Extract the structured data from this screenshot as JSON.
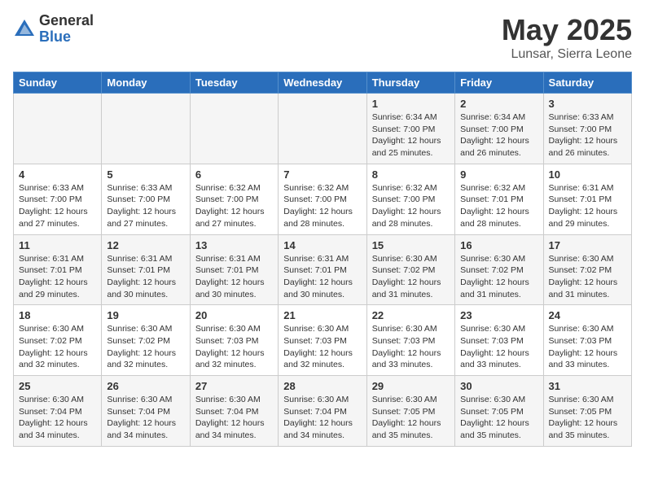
{
  "header": {
    "logo_general": "General",
    "logo_blue": "Blue",
    "title": "May 2025",
    "subtitle": "Lunsar, Sierra Leone"
  },
  "weekdays": [
    "Sunday",
    "Monday",
    "Tuesday",
    "Wednesday",
    "Thursday",
    "Friday",
    "Saturday"
  ],
  "weeks": [
    [
      {
        "day": "",
        "info": ""
      },
      {
        "day": "",
        "info": ""
      },
      {
        "day": "",
        "info": ""
      },
      {
        "day": "",
        "info": ""
      },
      {
        "day": "1",
        "info": "Sunrise: 6:34 AM\nSunset: 7:00 PM\nDaylight: 12 hours and 25 minutes."
      },
      {
        "day": "2",
        "info": "Sunrise: 6:34 AM\nSunset: 7:00 PM\nDaylight: 12 hours and 26 minutes."
      },
      {
        "day": "3",
        "info": "Sunrise: 6:33 AM\nSunset: 7:00 PM\nDaylight: 12 hours and 26 minutes."
      }
    ],
    [
      {
        "day": "4",
        "info": "Sunrise: 6:33 AM\nSunset: 7:00 PM\nDaylight: 12 hours and 27 minutes."
      },
      {
        "day": "5",
        "info": "Sunrise: 6:33 AM\nSunset: 7:00 PM\nDaylight: 12 hours and 27 minutes."
      },
      {
        "day": "6",
        "info": "Sunrise: 6:32 AM\nSunset: 7:00 PM\nDaylight: 12 hours and 27 minutes."
      },
      {
        "day": "7",
        "info": "Sunrise: 6:32 AM\nSunset: 7:00 PM\nDaylight: 12 hours and 28 minutes."
      },
      {
        "day": "8",
        "info": "Sunrise: 6:32 AM\nSunset: 7:00 PM\nDaylight: 12 hours and 28 minutes."
      },
      {
        "day": "9",
        "info": "Sunrise: 6:32 AM\nSunset: 7:01 PM\nDaylight: 12 hours and 28 minutes."
      },
      {
        "day": "10",
        "info": "Sunrise: 6:31 AM\nSunset: 7:01 PM\nDaylight: 12 hours and 29 minutes."
      }
    ],
    [
      {
        "day": "11",
        "info": "Sunrise: 6:31 AM\nSunset: 7:01 PM\nDaylight: 12 hours and 29 minutes."
      },
      {
        "day": "12",
        "info": "Sunrise: 6:31 AM\nSunset: 7:01 PM\nDaylight: 12 hours and 30 minutes."
      },
      {
        "day": "13",
        "info": "Sunrise: 6:31 AM\nSunset: 7:01 PM\nDaylight: 12 hours and 30 minutes."
      },
      {
        "day": "14",
        "info": "Sunrise: 6:31 AM\nSunset: 7:01 PM\nDaylight: 12 hours and 30 minutes."
      },
      {
        "day": "15",
        "info": "Sunrise: 6:30 AM\nSunset: 7:02 PM\nDaylight: 12 hours and 31 minutes."
      },
      {
        "day": "16",
        "info": "Sunrise: 6:30 AM\nSunset: 7:02 PM\nDaylight: 12 hours and 31 minutes."
      },
      {
        "day": "17",
        "info": "Sunrise: 6:30 AM\nSunset: 7:02 PM\nDaylight: 12 hours and 31 minutes."
      }
    ],
    [
      {
        "day": "18",
        "info": "Sunrise: 6:30 AM\nSunset: 7:02 PM\nDaylight: 12 hours and 32 minutes."
      },
      {
        "day": "19",
        "info": "Sunrise: 6:30 AM\nSunset: 7:02 PM\nDaylight: 12 hours and 32 minutes."
      },
      {
        "day": "20",
        "info": "Sunrise: 6:30 AM\nSunset: 7:03 PM\nDaylight: 12 hours and 32 minutes."
      },
      {
        "day": "21",
        "info": "Sunrise: 6:30 AM\nSunset: 7:03 PM\nDaylight: 12 hours and 32 minutes."
      },
      {
        "day": "22",
        "info": "Sunrise: 6:30 AM\nSunset: 7:03 PM\nDaylight: 12 hours and 33 minutes."
      },
      {
        "day": "23",
        "info": "Sunrise: 6:30 AM\nSunset: 7:03 PM\nDaylight: 12 hours and 33 minutes."
      },
      {
        "day": "24",
        "info": "Sunrise: 6:30 AM\nSunset: 7:03 PM\nDaylight: 12 hours and 33 minutes."
      }
    ],
    [
      {
        "day": "25",
        "info": "Sunrise: 6:30 AM\nSunset: 7:04 PM\nDaylight: 12 hours and 34 minutes."
      },
      {
        "day": "26",
        "info": "Sunrise: 6:30 AM\nSunset: 7:04 PM\nDaylight: 12 hours and 34 minutes."
      },
      {
        "day": "27",
        "info": "Sunrise: 6:30 AM\nSunset: 7:04 PM\nDaylight: 12 hours and 34 minutes."
      },
      {
        "day": "28",
        "info": "Sunrise: 6:30 AM\nSunset: 7:04 PM\nDaylight: 12 hours and 34 minutes."
      },
      {
        "day": "29",
        "info": "Sunrise: 6:30 AM\nSunset: 7:05 PM\nDaylight: 12 hours and 35 minutes."
      },
      {
        "day": "30",
        "info": "Sunrise: 6:30 AM\nSunset: 7:05 PM\nDaylight: 12 hours and 35 minutes."
      },
      {
        "day": "31",
        "info": "Sunrise: 6:30 AM\nSunset: 7:05 PM\nDaylight: 12 hours and 35 minutes."
      }
    ]
  ]
}
